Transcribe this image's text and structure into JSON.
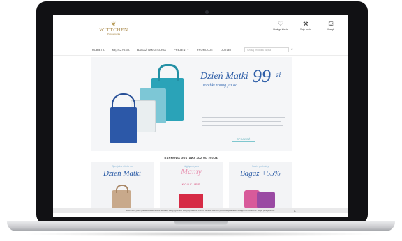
{
  "site": {
    "logo": {
      "crest_glyph": "❦",
      "name": "WITTCHEN",
      "tagline": "Polska marka"
    },
    "header_icons": [
      {
        "icon": "heart-hanger-icon",
        "glyph": "♡",
        "label": "Obsługa klienta"
      },
      {
        "icon": "wrench-icon",
        "glyph": "⚒",
        "label": "Moje konto"
      },
      {
        "icon": "bag-icon",
        "glyph": "⛋",
        "label": "Koszyk"
      }
    ],
    "nav": [
      "KOBIETA",
      "MĘŻCZYZNA",
      "BAGAŻ I AKCESORIA",
      "PREZENTY",
      "PROMOCJE",
      "OUTLET"
    ],
    "search": {
      "placeholder": "Szukaj produktu Wpisz",
      "button_glyph": "⌕"
    }
  },
  "hero": {
    "title": "Dzień Matki",
    "subtitle": "torebki Young już od",
    "price": "99",
    "currency": "zł",
    "button_label": "SPRAWDŹ"
  },
  "promo": {
    "heading": "DARMOWA DOSTAWA JUŻ OD 200 ZŁ",
    "cards": [
      {
        "top": "Specjalna oferta na",
        "title": "Dzień Matki"
      },
      {
        "top": "Najpiękniejsza",
        "title": "Mamy",
        "sub": "KONKURS"
      },
      {
        "top": "Pakiet podróżny",
        "title": "Bagaż +55%"
      }
    ]
  },
  "cookie": {
    "text": "Strona korzysta z plików cookies w celu realizacji usług zgodnie z Polityką cookies. Możesz określić warunki przechowywania lub dostępu do cookies w Twojej przeglądarce.",
    "close_glyph": "✕"
  },
  "colors": {
    "brand_blue": "#2f5fa8",
    "gold": "#b79a55",
    "teal": "#4ea9b4",
    "pink": "#e896b4"
  }
}
